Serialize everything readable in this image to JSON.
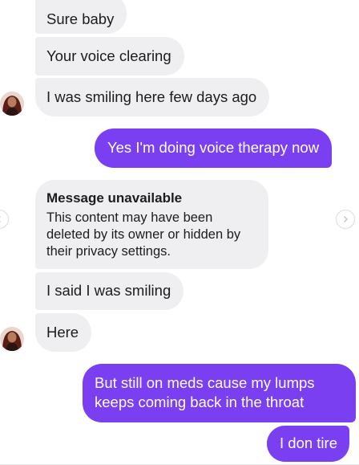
{
  "messages": {
    "m1": "Sure baby",
    "m2": "Your voice clearing",
    "m3": "I was smiling here few days ago",
    "m4": "Yes I'm doing voice therapy now",
    "unavailable_title": "Message unavailable",
    "unavailable_body": "This content may have been deleted by its owner or hidden by their privacy settings.",
    "m6": "I said I was smiling",
    "m7": "Here",
    "m8_line1": "But still on meds cause my lumps",
    "m8_line2": "keeps coming back in the throat",
    "m9": "I don tire"
  },
  "icons": {
    "avatar": "contact-avatar",
    "prev": "chevron-left-icon",
    "next": "chevron-right-icon"
  },
  "colors": {
    "incoming_bubble": "#efeff1",
    "outgoing_bubble": "#7b3ff2",
    "incoming_text": "#1c1c1e",
    "outgoing_text": "#ffffff"
  }
}
